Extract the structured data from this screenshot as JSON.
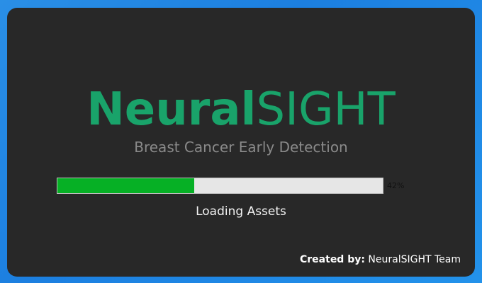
{
  "brand": {
    "name_bold": "Neural",
    "name_light": "SIGHT",
    "subtitle": "Breast Cancer Early Detection"
  },
  "progress": {
    "value": 0.42,
    "label": "42%"
  },
  "status": {
    "text": "Loading Assets"
  },
  "credit": {
    "label": "Created by:",
    "value": "NeuralSIGHT Team"
  },
  "colors": {
    "brand": "#19a36a",
    "progress_fill": "#06b025",
    "panel": "#282828",
    "desktop": "#1c7fe0"
  }
}
